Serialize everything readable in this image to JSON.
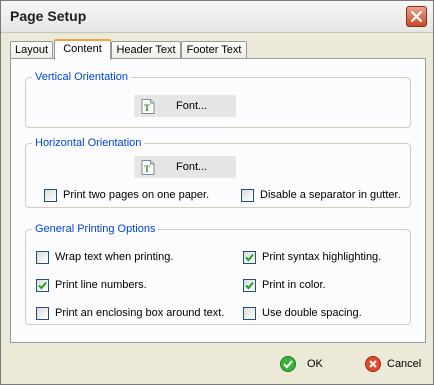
{
  "window": {
    "title": "Page Setup"
  },
  "tabs": [
    {
      "label": "Layout",
      "active": false
    },
    {
      "label": "Content",
      "active": true
    },
    {
      "label": "Header Text",
      "active": false
    },
    {
      "label": "Footer Text",
      "active": false
    }
  ],
  "vertical": {
    "title": "Vertical Orientation",
    "font_button": "Font..."
  },
  "horizontal": {
    "title": "Horizontal Orientation",
    "font_button": "Font...",
    "options": [
      {
        "label": "Print two pages on one paper.",
        "checked": false
      },
      {
        "label": "Disable a separator in gutter.",
        "checked": false
      }
    ]
  },
  "general": {
    "title": "General Printing Options",
    "options": [
      {
        "label": "Wrap text when printing.",
        "checked": false
      },
      {
        "label": "Print syntax highlighting.",
        "checked": true
      },
      {
        "label": "Print line numbers.",
        "checked": true
      },
      {
        "label": "Print in color.",
        "checked": true
      },
      {
        "label": "Print an enclosing box around text.",
        "checked": false
      },
      {
        "label": "Use double spacing.",
        "checked": false
      }
    ]
  },
  "buttons": {
    "ok": "OK",
    "cancel": "Cancel"
  },
  "colors": {
    "group_title": "#0046d5",
    "active_tab_accent": "#f1a23e",
    "check_mark": "#21a121"
  }
}
